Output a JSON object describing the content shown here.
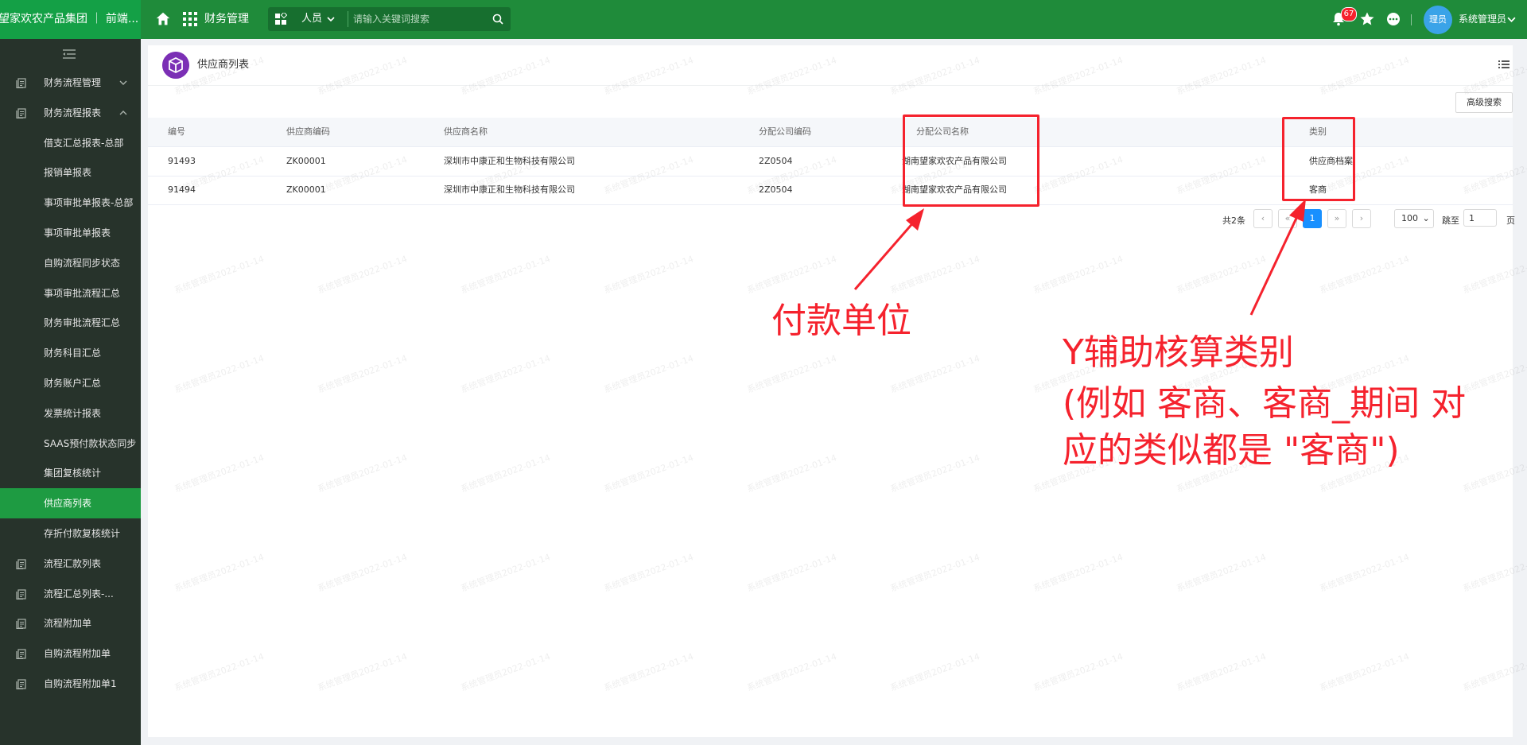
{
  "header": {
    "brand": "望家欢农产品集团 ｜ 前端...",
    "module": "财务管理",
    "search_scope": "人员",
    "search_placeholder": "请输入关键词搜索",
    "notification_count": "67",
    "avatar_text": "理员",
    "user_name": "系统管理员"
  },
  "sidebar": {
    "items": [
      {
        "label": "财务流程管理",
        "type": "group"
      },
      {
        "label": "财务流程报表",
        "type": "group"
      },
      {
        "label": "借支汇总报表-总部",
        "type": "sub"
      },
      {
        "label": "报销单报表",
        "type": "sub"
      },
      {
        "label": "事项审批单报表-总部",
        "type": "sub"
      },
      {
        "label": "事项审批单报表",
        "type": "sub"
      },
      {
        "label": "自购流程同步状态",
        "type": "sub"
      },
      {
        "label": "事项审批流程汇总",
        "type": "sub"
      },
      {
        "label": "财务审批流程汇总",
        "type": "sub"
      },
      {
        "label": "财务科目汇总",
        "type": "sub"
      },
      {
        "label": "财务账户汇总",
        "type": "sub"
      },
      {
        "label": "发票统计报表",
        "type": "sub"
      },
      {
        "label": "SAAS预付款状态同步",
        "type": "sub"
      },
      {
        "label": "集团复核统计",
        "type": "sub"
      },
      {
        "label": "供应商列表",
        "type": "sub",
        "active": true
      },
      {
        "label": "存折付款复核统计",
        "type": "sub"
      },
      {
        "label": "流程汇款列表",
        "type": "group"
      },
      {
        "label": "流程汇总列表-...",
        "type": "group"
      },
      {
        "label": "流程附加单",
        "type": "group"
      },
      {
        "label": "自购流程附加单",
        "type": "group"
      },
      {
        "label": "自购流程附加单1",
        "type": "group"
      }
    ]
  },
  "page": {
    "title": "供应商列表",
    "advanced_search": "高级搜索"
  },
  "table": {
    "columns": [
      "编号",
      "供应商编码",
      "供应商名称",
      "分配公司编码",
      "分配公司名称",
      "类别"
    ],
    "rows": [
      [
        "91493",
        "ZK00001",
        "深圳市中康正和生物科技有限公司",
        "2Z0504",
        "湖南望家欢农产品有限公司",
        "供应商档案"
      ],
      [
        "91494",
        "ZK00001",
        "深圳市中康正和生物科技有限公司",
        "2Z0504",
        "湖南望家欢农产品有限公司",
        "客商"
      ]
    ]
  },
  "pagination": {
    "total": "共2条",
    "current_page": "1",
    "page_size": "100",
    "goto_label": "跳至",
    "goto_value": "1",
    "page_suffix": "页"
  },
  "watermark": "系统管理员2022-01-14",
  "annotations": {
    "label_1": "付款单位",
    "label_2_line1": "Y辅助核算类别",
    "label_2_line2": "(例如 客商、客商_期间 对",
    "label_2_line3": "应的类似都是 \"客商\")",
    "color": "#f5222d"
  },
  "colors": {
    "topbar": "#1f8b3a",
    "brand": "#14a046",
    "sidebar": "#27332b",
    "active": "#1e9b42",
    "pager_active": "#1890ff"
  }
}
